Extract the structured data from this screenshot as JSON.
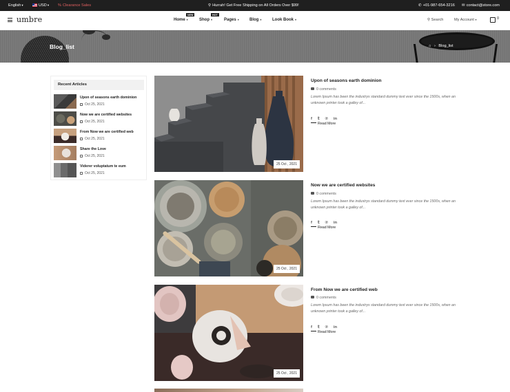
{
  "topbar": {
    "language": "English",
    "currency": "USD",
    "clearance": "Clearance Sales",
    "promo": "Hurrah! Get Free Shipping on All Orders Over $99!",
    "phone": "+01-987-654-3216",
    "email": "contact@store.com"
  },
  "nav": {
    "logo": "umbre",
    "items": [
      {
        "label": "Home",
        "badge": "NEW"
      },
      {
        "label": "Shop",
        "badge": "HOT"
      },
      {
        "label": "Pages",
        "badge": ""
      },
      {
        "label": "Blog",
        "badge": ""
      },
      {
        "label": "Look Book",
        "badge": ""
      }
    ],
    "search": "Search",
    "account": "My Account",
    "cart_count": "0"
  },
  "banner": {
    "title": "Blog_list",
    "breadcrumb": "Blog_list"
  },
  "sidebar": {
    "heading": "Recent Articles",
    "articles": [
      {
        "title": "Upon of seasons earth dominion",
        "date": "Oct 25, 2021"
      },
      {
        "title": "Now we are certified websites",
        "date": "Oct 25, 2021"
      },
      {
        "title": "From Now we are certified web",
        "date": "Oct 25, 2021"
      },
      {
        "title": "Share the Love",
        "date": "Oct 25, 2021"
      },
      {
        "title": "Viderer voluptatum te eum",
        "date": "Oct 25, 2021"
      }
    ]
  },
  "posts": [
    {
      "title": "Upon of seasons earth dominion",
      "comments": "0 comments",
      "excerpt": "Lorem Ipsum has been the industrys standard dummy text ever since the 1500s, when an unknown printer took a galley of...",
      "date": "25 Oct , 2021",
      "read_more": "Read More"
    },
    {
      "title": "Now we are certified websites",
      "comments": "0 comments",
      "excerpt": "Lorem Ipsum has been the industrys standard dummy text ever since the 1500s, when an unknown printer took a galley of...",
      "date": "25 Oct , 2021",
      "read_more": "Read More"
    },
    {
      "title": "From Now we are certified web",
      "comments": "0 comments",
      "excerpt": "Lorem Ipsum has been the industrys standard dummy text ever since the 1500s, when an unknown printer took a galley of...",
      "date": "25 Oct , 2021",
      "read_more": "Read More"
    }
  ],
  "social_icons": [
    "facebook-icon",
    "twitter-icon",
    "pinterest-icon",
    "linkedin-icon"
  ],
  "colors": {
    "topbar": "#1f1f1f",
    "clearance": "#e06060",
    "banner": "#7a7a7a"
  }
}
